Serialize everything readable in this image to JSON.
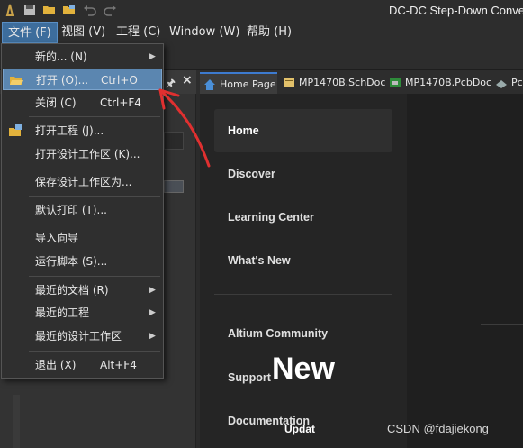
{
  "window": {
    "title": "DC-DC Step-Down Conve"
  },
  "menubar": {
    "items": [
      {
        "label": "文件 (F)"
      },
      {
        "label": "视图 (V)"
      },
      {
        "label": "工程 (C)"
      },
      {
        "label": "Window (W)"
      },
      {
        "label": "帮助 (H)"
      }
    ]
  },
  "file_menu": {
    "items": [
      {
        "label": "新的... (N)",
        "shortcut": "",
        "submenu": true
      },
      {
        "label": "打开 (O)...",
        "shortcut": "Ctrl+O",
        "submenu": false,
        "highlighted": true
      },
      {
        "label": "关闭 (C)",
        "shortcut": "Ctrl+F4",
        "submenu": false
      },
      {
        "label": "打开工程 (J)...",
        "shortcut": "",
        "submenu": false
      },
      {
        "label": "打开设计工作区 (K)...",
        "shortcut": "",
        "submenu": false
      },
      {
        "label": "保存设计工作区为...",
        "shortcut": "",
        "submenu": false
      },
      {
        "label": "默认打印 (T)...",
        "shortcut": "",
        "submenu": false
      },
      {
        "label": "导入向导",
        "shortcut": "",
        "submenu": false
      },
      {
        "label": "运行脚本 (S)...",
        "shortcut": "",
        "submenu": false
      },
      {
        "label": "最近的文档 (R)",
        "shortcut": "",
        "submenu": true
      },
      {
        "label": "最近的工程",
        "shortcut": "",
        "submenu": true
      },
      {
        "label": "最近的设计工作区",
        "shortcut": "",
        "submenu": true
      },
      {
        "label": "退出 (X)",
        "shortcut": "Alt+F4",
        "submenu": false
      }
    ]
  },
  "tabs": [
    {
      "label": "Home Page",
      "icon": "home-icon",
      "active": true
    },
    {
      "label": "MP1470B.SchDoc",
      "icon": "schematic-icon",
      "active": false
    },
    {
      "label": "MP1470B.PcbDoc",
      "icon": "pcb-icon",
      "active": false
    },
    {
      "label": "Pc",
      "icon": "pcb-3d-icon",
      "active": false
    }
  ],
  "home_nav": {
    "items": [
      {
        "label": "Home",
        "selected": true
      },
      {
        "label": "Discover"
      },
      {
        "label": "Learning Center"
      },
      {
        "label": "What's New"
      },
      {
        "label": "Altium Community"
      },
      {
        "label": "Support"
      },
      {
        "label": "Documentation"
      }
    ]
  },
  "home_main": {
    "heading": "New",
    "update_label": "Updat"
  },
  "watermark": "CSDN @fdajiekong",
  "colors": {
    "accent": "#5b86b0",
    "annotation": "#e03030",
    "tab_active_border": "#3d7bd0"
  }
}
